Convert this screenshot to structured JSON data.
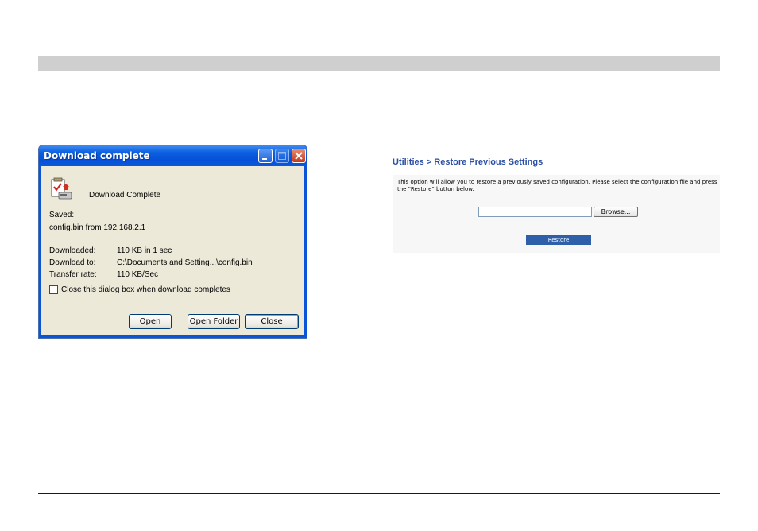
{
  "dialog": {
    "title": "Download complete",
    "status": "Download Complete",
    "saved_label": "Saved:",
    "saved_value": "config.bin from 192.168.2.1",
    "rows": [
      {
        "label": "Downloaded:",
        "value": "110 KB in 1 sec"
      },
      {
        "label": "Download to:",
        "value": "C:\\Documents and Setting...\\config.bin"
      },
      {
        "label": "Transfer rate:",
        "value": "110 KB/Sec"
      }
    ],
    "checkbox_label": "Close this dialog box when download completes",
    "checkbox_checked": false,
    "buttons": {
      "open": "Open",
      "open_folder": "Open Folder",
      "close": "Close"
    },
    "icons": {
      "minimize": "minimize-icon",
      "maximize": "maximize-icon",
      "close": "close-icon",
      "download": "download-complete-icon"
    }
  },
  "router": {
    "heading": "Utilities > Restore Previous Settings",
    "description": "This option will allow you to restore a previously saved configuration. Please select the configuration file and press the \"Restore\" button below.",
    "file_input_value": "",
    "browse_label": "Browse...",
    "restore_label": "Restore"
  },
  "colors": {
    "titlebar": "#0a54d8",
    "dialog_bg": "#ece9d8",
    "router_heading": "#2a4fa3",
    "restore_button": "#2e5fa8",
    "top_bar": "#cfcfd0"
  }
}
